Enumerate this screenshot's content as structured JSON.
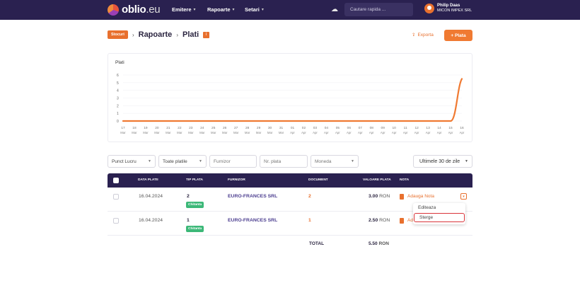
{
  "header": {
    "logo_text": "oblio",
    "logo_suffix": ".eu",
    "nav": [
      "Emitere",
      "Rapoarte",
      "Setari"
    ],
    "search_placeholder": "Cautare rapida ...",
    "user_name": "Philip Daas",
    "company": "MICON IMPEX SRL"
  },
  "breadcrumb": {
    "badge": "Stocuri",
    "items": [
      "Rapoarte",
      "Plati"
    ]
  },
  "actions": {
    "export": "Exporta",
    "add": "+ Plata"
  },
  "chart_data": {
    "type": "line",
    "title": "Plati",
    "ylim": [
      0,
      6
    ],
    "y_ticks": [
      "0",
      "1",
      "2",
      "3",
      "4",
      "5",
      "6"
    ],
    "categories": [
      [
        "17",
        "Mar"
      ],
      [
        "18",
        "Mar"
      ],
      [
        "19",
        "Mar"
      ],
      [
        "20",
        "Mar"
      ],
      [
        "21",
        "Mar"
      ],
      [
        "22",
        "Mar"
      ],
      [
        "23",
        "Mar"
      ],
      [
        "24",
        "Mar"
      ],
      [
        "25",
        "Mar"
      ],
      [
        "26",
        "Mar"
      ],
      [
        "27",
        "Mar"
      ],
      [
        "28",
        "Mar"
      ],
      [
        "29",
        "Mar"
      ],
      [
        "30",
        "Mar"
      ],
      [
        "31",
        "Mar"
      ],
      [
        "01",
        "Apr"
      ],
      [
        "02",
        "Apr"
      ],
      [
        "03",
        "Apr"
      ],
      [
        "04",
        "Apr"
      ],
      [
        "05",
        "Apr"
      ],
      [
        "06",
        "Apr"
      ],
      [
        "07",
        "Apr"
      ],
      [
        "08",
        "Apr"
      ],
      [
        "09",
        "Apr"
      ],
      [
        "10",
        "Apr"
      ],
      [
        "11",
        "Apr"
      ],
      [
        "12",
        "Apr"
      ],
      [
        "13",
        "Apr"
      ],
      [
        "14",
        "Apr"
      ],
      [
        "15",
        "Apr"
      ],
      [
        "16",
        "Apr"
      ]
    ],
    "values": [
      0,
      0,
      0,
      0,
      0,
      0,
      0,
      0,
      0,
      0,
      0,
      0,
      0,
      0,
      0,
      0,
      0,
      0,
      0,
      0,
      0,
      0,
      0,
      0,
      0,
      0,
      0,
      0,
      0,
      0,
      5.5
    ],
    "color": "#f07a32",
    "grid": true
  },
  "filters": {
    "punct_lucru": "Punct Lucru",
    "toate_platile": "Toate platile",
    "furnizor": "Furnizor",
    "nr_plata": "Nr. plata",
    "moneda": "Moneda",
    "period": "Ultimele 30 de zile"
  },
  "table": {
    "headers": [
      "DATA PLATII",
      "TIP PLATA",
      "FURNIZOR",
      "DOCUMENT",
      "VALOARE PLATA",
      "NOTA"
    ],
    "rows": [
      {
        "date": "16.04.2024",
        "tip": "2",
        "tag": "Chitanta",
        "furnizor": "EURO-FRANCES SRL",
        "document": "2",
        "value": "3.00",
        "currency": "RON",
        "note": "Adauga Nota"
      },
      {
        "date": "16.04.2024",
        "tip": "1",
        "tag": "Chitanta",
        "furnizor": "EURO-FRANCES SRL",
        "document": "1",
        "value": "2.50",
        "currency": "RON",
        "note": "Ad"
      }
    ],
    "total_label": "TOTAL",
    "total_value": "5.50",
    "total_currency": "RON"
  },
  "menu": {
    "items": [
      "Editeaza",
      "Sterge"
    ]
  }
}
